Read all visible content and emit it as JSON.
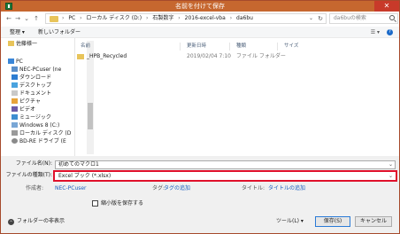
{
  "window": {
    "title": "名前を付けて保存",
    "close_glyph": "✕"
  },
  "address_bar": {
    "back_glyph": "←",
    "forward_glyph": "→",
    "recent_glyph": "⌄",
    "up_glyph": "↑",
    "breadcrumbs": [
      "PC",
      "ローカル ディスク (D:)",
      "石製数字",
      "2016-excel-vba",
      "da6bu"
    ],
    "separator": "›",
    "dropdown_glyph": "⌄",
    "refresh_glyph": "↻"
  },
  "search": {
    "placeholder": "da6buの検索"
  },
  "command_bar": {
    "organize": "整理 ▾",
    "new_folder": "新しいフォルダー",
    "view_glyph": "☰ ▾",
    "help_glyph": "?"
  },
  "nav_pane": {
    "items": [
      {
        "label": "佐藤様一",
        "icon": "user-folder"
      },
      {
        "label": "PC",
        "icon": "pc"
      },
      {
        "label": "NEC-PCuser (ne",
        "icon": "network-user"
      },
      {
        "label": "ダウンロード",
        "icon": "downloads"
      },
      {
        "label": "デスクトップ",
        "icon": "desktop"
      },
      {
        "label": "ドキュメント",
        "icon": "documents"
      },
      {
        "label": "ピクチャ",
        "icon": "pictures"
      },
      {
        "label": "ビデオ",
        "icon": "videos"
      },
      {
        "label": "ミュージック",
        "icon": "music"
      },
      {
        "label": "Windows 8 (C:)",
        "icon": "drive"
      },
      {
        "label": "ローカル ディスク (D",
        "icon": "drive"
      },
      {
        "label": "BD-RE ドライブ (E",
        "icon": "optical-drive"
      }
    ]
  },
  "file_list": {
    "columns": [
      "名前",
      "更新日時",
      "種類",
      "サイズ"
    ],
    "rows": [
      {
        "name": "_HPB_Recycled",
        "modified": "2019/02/04 7:10",
        "type": "ファイル フォルダー",
        "size": ""
      }
    ]
  },
  "form": {
    "filename_label": "ファイル名(N):",
    "filename_value": "初めてのマクロ1",
    "filetype_label": "ファイルの種類(T):",
    "filetype_value": "Excel ブック (*.xlsx)",
    "author_label": "作成者:",
    "author_value": "NEC-PCuser",
    "tags_label": "タグ:",
    "tags_value": "タグの追加",
    "title_label": "タイトル:",
    "title_value": "タイトルの追加",
    "thumbnail_label": "縮小版を保存する",
    "thumbnail_checked": false,
    "chevron": "⌄"
  },
  "footer": {
    "hide_folders": "フォルダーの非表示",
    "hide_glyph": "^",
    "tools": "ツール(L) ▾",
    "save": "保存(S)",
    "cancel": "キャンセル"
  },
  "colors": {
    "titlebar": "#c6672f",
    "highlight": "#e0102b",
    "link": "#1b5fbf"
  }
}
